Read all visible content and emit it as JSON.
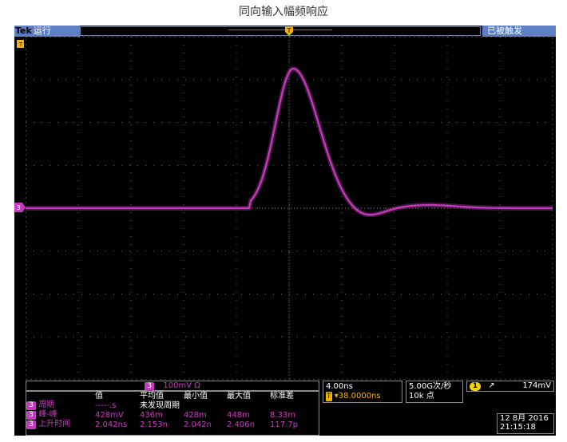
{
  "page_title": "同向输入幅频响应",
  "topbar": {
    "brand": "Tek",
    "run_state": "运行",
    "trigger_status": "已被触发"
  },
  "channel_bar": {
    "channel": "3",
    "scale": "100mV Ω"
  },
  "measurements": {
    "headers": [
      "",
      "值",
      "平均值",
      "最小值",
      "最大值",
      "标准差"
    ],
    "rows": [
      {
        "ch": "3",
        "name": "周期",
        "value": "-----.s",
        "note": "未发现周期"
      },
      {
        "ch": "3",
        "name": "峰-峰",
        "value": "428mV",
        "mean": "436m",
        "min": "428m",
        "max": "448m",
        "std": "8.33m"
      },
      {
        "ch": "3",
        "name": "上升时间",
        "value": "2.042ns",
        "mean": "2.153n",
        "min": "2.042n",
        "max": "2.406n",
        "std": "117.7p"
      }
    ]
  },
  "timebase": {
    "scale": "4.00ns",
    "delay": "▾38.0000ns"
  },
  "acquisition": {
    "sample_rate": "5.00G次/秒",
    "record_length": "10k 点"
  },
  "trigger": {
    "source": "1",
    "slope": "↗",
    "level": "174mV"
  },
  "datetime": {
    "date": "12 8月 2016",
    "time": "21:15:18"
  },
  "colors": {
    "trace": "#c63bbd",
    "trigger_marker": "#f2b400"
  }
}
